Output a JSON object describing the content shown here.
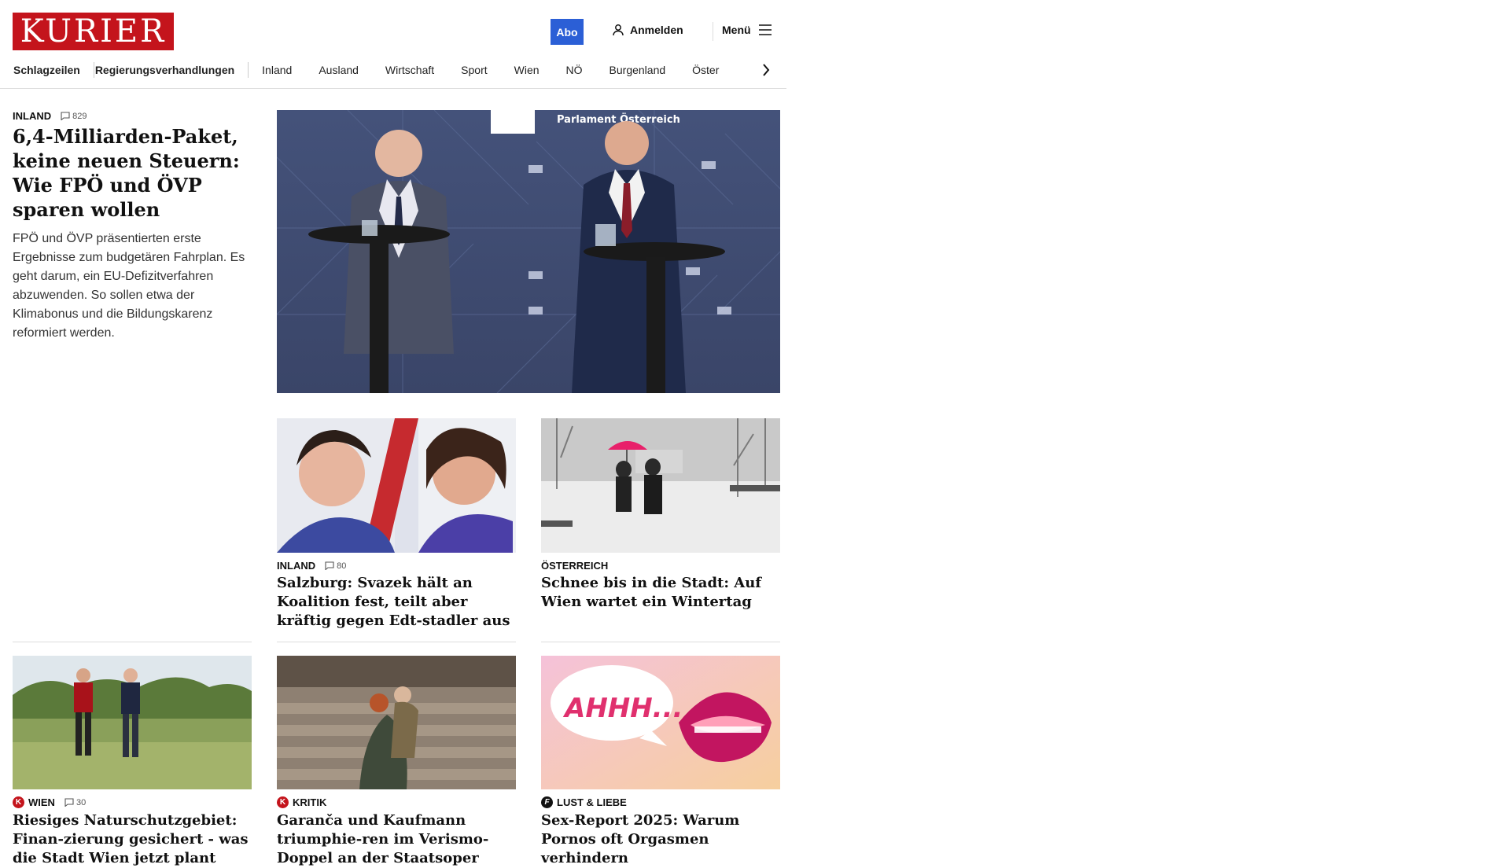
{
  "header": {
    "logo": "KURIER",
    "abo_label": "Abo",
    "login_label": "Anmelden",
    "menu_label": "Menü"
  },
  "nav": {
    "items": [
      "Schlagzeilen",
      "Regierungsverhandlungen",
      "Inland",
      "Ausland",
      "Wirtschaft",
      "Sport",
      "Wien",
      "NÖ",
      "Burgenland",
      "Öster"
    ]
  },
  "lead": {
    "category": "INLAND",
    "comments": "829",
    "title": "6,4-Milliarden-Paket, keine neuen Steuern: Wie FPÖ und ÖVP sparen wollen",
    "teaser": "FPÖ und ÖVP präsentierten erste Ergebnisse zum budgetären Fahrplan. Es geht darum, ein EU-Defizitverfahren abzuwenden. So sollen etwa der Klimabonus und die Bildungskarenz reformiert werden.",
    "image_text": "Parlament Österreich"
  },
  "cards": [
    {
      "category": "INLAND",
      "comments": "80",
      "title": "Salzburg: Svazek hält an Koalition fest, teilt aber kräftig gegen Edt-stadler aus"
    },
    {
      "category": "ÖSTERREICH",
      "title": "Schnee bis in die Stadt: Auf Wien wartet ein Wintertag"
    },
    {
      "category": "WIEN",
      "badge": "K",
      "comments": "30",
      "title": "Riesiges Naturschutzgebiet: Finan-zierung gesichert - was die Stadt Wien jetzt plant"
    },
    {
      "category": "KRITIK",
      "badge": "K",
      "title": "Garanča und Kaufmann triumphie-ren im Verismo-Doppel an der Staatsoper"
    },
    {
      "category": "LUST & LIEBE",
      "badge": "f",
      "title": "Sex-Report 2025: Warum Pornos oft Orgasmen verhindern",
      "image_text": "AHHH..."
    }
  ],
  "colors": {
    "brand": "#c4141c",
    "abo": "#2b5fd6"
  },
  "icons": {
    "user": "user-icon",
    "menu": "hamburger-icon",
    "comment": "comment-icon",
    "next": "chevron-right-icon"
  }
}
